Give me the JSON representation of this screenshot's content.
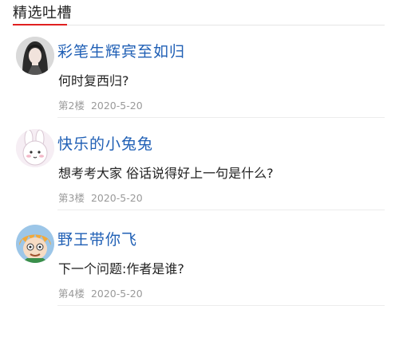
{
  "section": {
    "title": "精选吐槽",
    "accent_color": "#e02020"
  },
  "comments": [
    {
      "username": "彩笔生辉宾至如归",
      "avatar": "dark-haired-character-avatar",
      "text": "何时复西归?",
      "floor": "第2楼",
      "date": "2020-5-20"
    },
    {
      "username": "快乐的小兔兔",
      "avatar": "white-bunny-avatar",
      "text": "想考考大家 俗话说得好上一句是什么?",
      "floor": "第3楼",
      "date": "2020-5-20"
    },
    {
      "username": "野王带你飞",
      "avatar": "cartoon-kid-avatar",
      "text": "下一个问题:作者是谁?",
      "floor": "第4楼",
      "date": "2020-5-20"
    }
  ]
}
